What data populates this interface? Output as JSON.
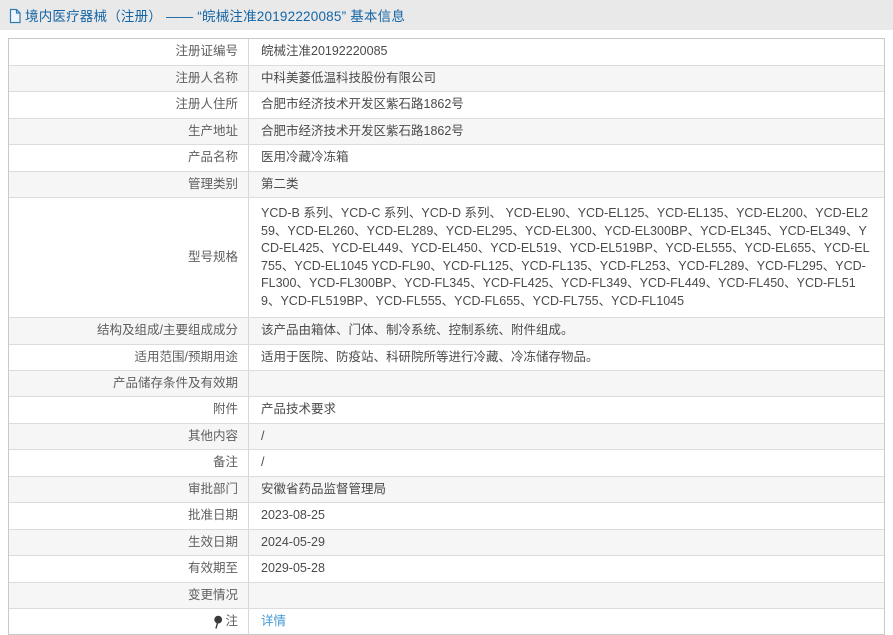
{
  "header": {
    "title": "境内医疗器械（注册） —— “皖械注准20192220085” 基本信息"
  },
  "colors": {
    "title_blue": "#1565a5",
    "link_blue": "#4198d3",
    "band_bg": "#e9e9e9",
    "alt_row_bg": "#f6f6f6"
  },
  "icons": {
    "header": "document-icon",
    "note_row": "pin-icon"
  },
  "table": {
    "rows": [
      {
        "label": "注册证编号",
        "value": "皖械注准20192220085"
      },
      {
        "label": "注册人名称",
        "value": "中科美菱低温科技股份有限公司"
      },
      {
        "label": "注册人住所",
        "value": "合肥市经济技术开发区紫石路1862号"
      },
      {
        "label": "生产地址",
        "value": "合肥市经济技术开发区紫石路1862号"
      },
      {
        "label": "产品名称",
        "value": "医用冷藏冷冻箱"
      },
      {
        "label": "管理类别",
        "value": "第二类"
      },
      {
        "label": "型号规格",
        "value": "YCD-B 系列、YCD-C 系列、YCD-D 系列、 YCD-EL90、YCD-EL125、YCD-EL135、YCD-EL200、YCD-EL259、YCD-EL260、YCD-EL289、YCD-EL295、YCD-EL300、YCD-EL300BP、YCD-EL345、YCD-EL349、YCD-EL425、YCD-EL449、YCD-EL450、YCD-EL519、YCD-EL519BP、YCD-EL555、YCD-EL655、YCD-EL755、YCD-EL1045 YCD-FL90、YCD-FL125、YCD-FL135、YCD-FL253、YCD-FL289、YCD-FL295、YCD-FL300、YCD-FL300BP、YCD-FL345、YCD-FL425、YCD-FL349、YCD-FL449、YCD-FL450、YCD-FL519、YCD-FL519BP、YCD-FL555、YCD-FL655、YCD-FL755、YCD-FL1045"
      },
      {
        "label": "结构及组成/主要组成成分",
        "value": "该产品由箱体、门体、制冷系统、控制系统、附件组成。"
      },
      {
        "label": "适用范围/预期用途",
        "value": "适用于医院、防疫站、科研院所等进行冷藏、冷冻储存物品。"
      },
      {
        "label": "产品储存条件及有效期",
        "value": ""
      },
      {
        "label": "附件",
        "value": "产品技术要求"
      },
      {
        "label": "其他内容",
        "value": "/"
      },
      {
        "label": "备注",
        "value": "/"
      },
      {
        "label": "审批部门",
        "value": "安徽省药品监督管理局"
      },
      {
        "label": "批准日期",
        "value": "2023-08-25"
      },
      {
        "label": "生效日期",
        "value": "2024-05-29"
      },
      {
        "label": "有效期至",
        "value": "2029-05-28"
      },
      {
        "label": "变更情况",
        "value": ""
      },
      {
        "label": "注",
        "value": "详情"
      }
    ]
  }
}
